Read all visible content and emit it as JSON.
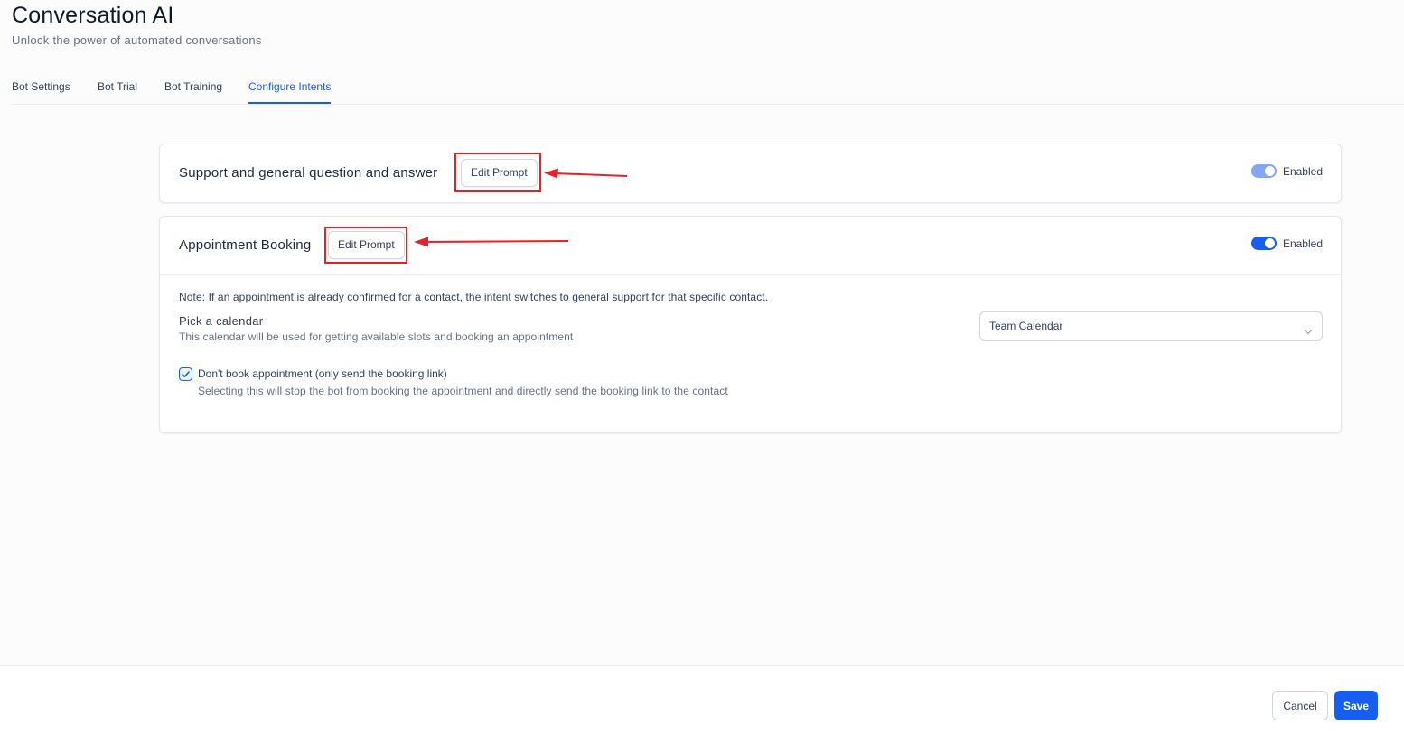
{
  "header": {
    "title": "Conversation AI",
    "subtitle": "Unlock the power of automated conversations"
  },
  "tabs": [
    {
      "label": "Bot Settings",
      "active": false
    },
    {
      "label": "Bot Trial",
      "active": false
    },
    {
      "label": "Bot Training",
      "active": false
    },
    {
      "label": "Configure Intents",
      "active": true
    }
  ],
  "intents": [
    {
      "title": "Support and general question and answer",
      "edit_label": "Edit Prompt",
      "toggle_label": "Enabled",
      "toggle_color": "#84a7f5"
    },
    {
      "title": "Appointment Booking",
      "edit_label": "Edit Prompt",
      "toggle_label": "Enabled",
      "toggle_color": "#155eef",
      "note": "Note: If an appointment is already confirmed for a contact, the intent switches to general support for that specific contact.",
      "calendar": {
        "label": "Pick a calendar",
        "help": "This calendar will be used for getting available slots and booking an appointment",
        "selected": "Team Calendar"
      },
      "checkbox": {
        "label": "Don't book appointment (only send the booking link)",
        "help": "Selecting this will stop the bot from booking the appointment and directly send the booking link to the contact",
        "checked": true
      }
    }
  ],
  "footer": {
    "cancel_label": "Cancel",
    "save_label": "Save"
  },
  "colors": {
    "accent": "#155eef",
    "annotation": "#e0242a"
  },
  "icons": [
    "chevron-down-icon",
    "checkmark-icon",
    "annotation-arrow-icon"
  ]
}
